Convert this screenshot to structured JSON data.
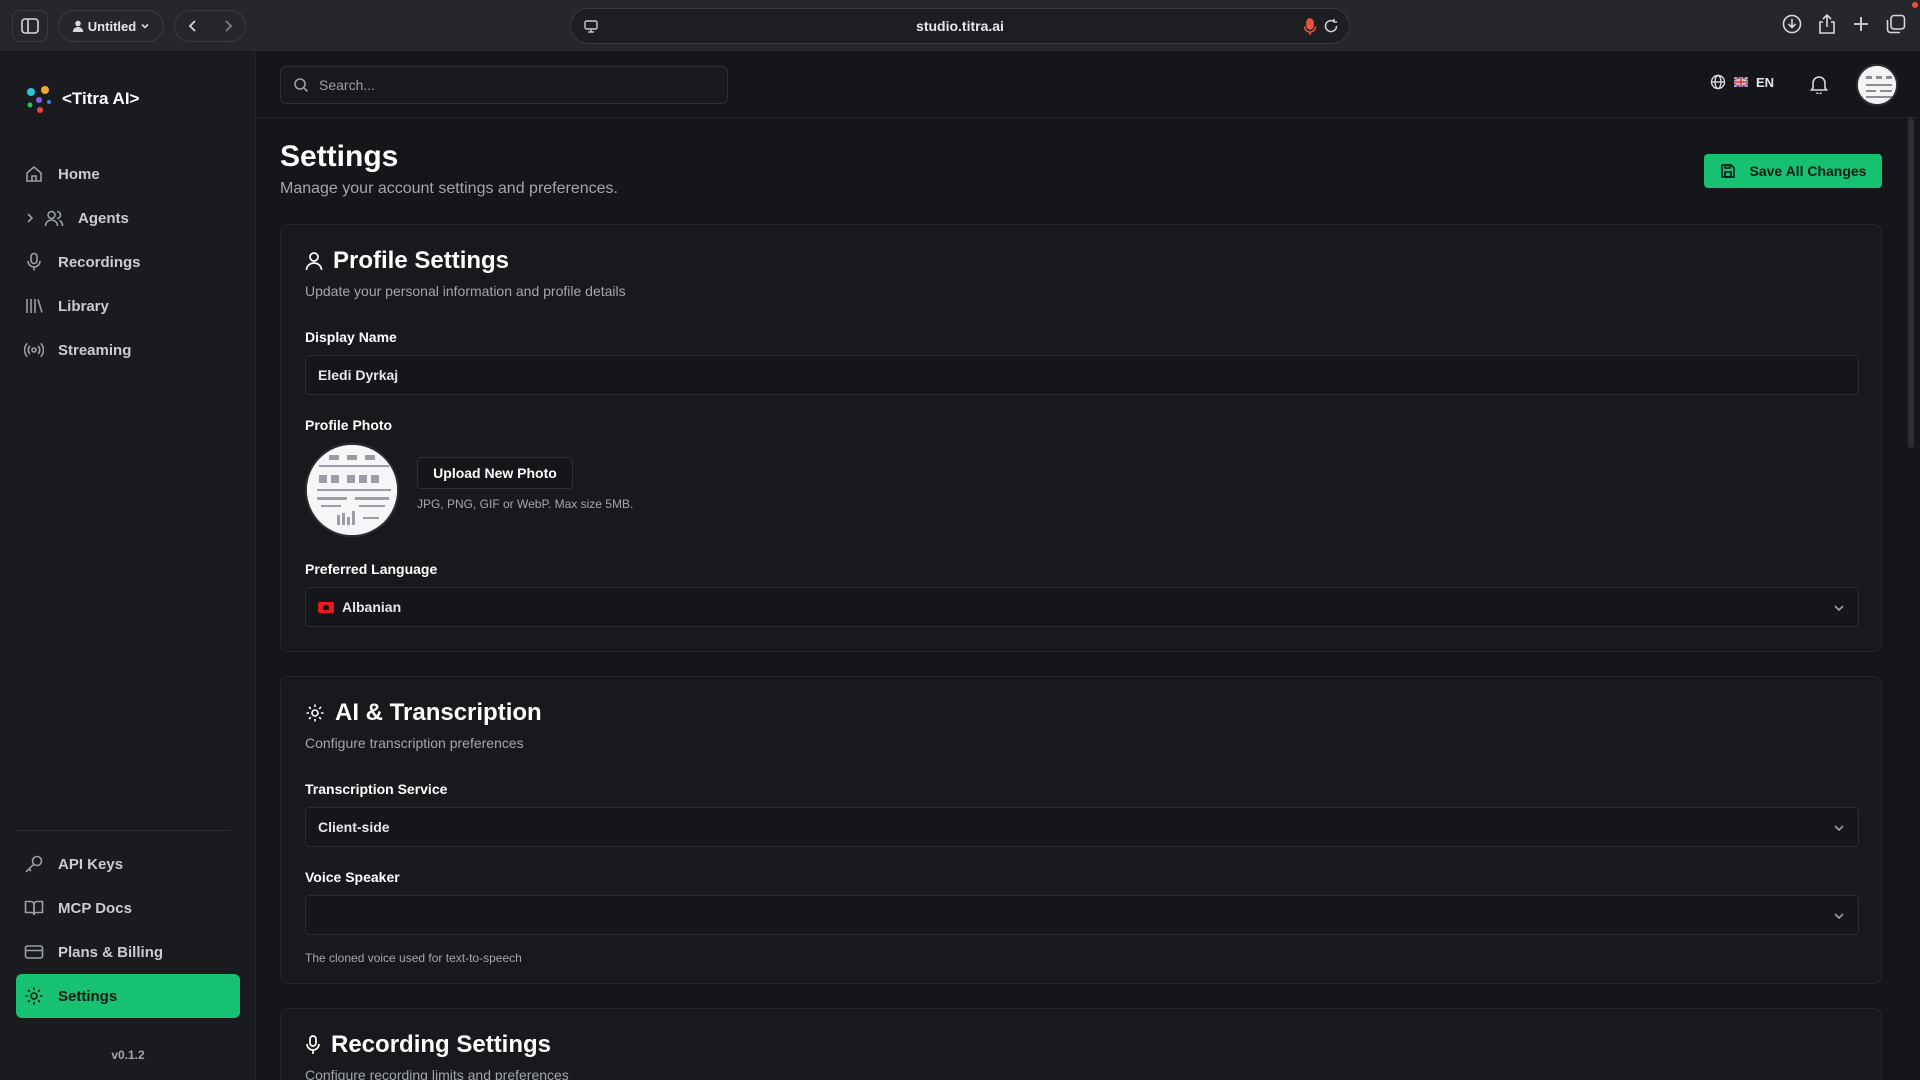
{
  "browser": {
    "profile_label": "Untitled",
    "url": "studio.titra.ai"
  },
  "brand": {
    "name": "<Titra AI>"
  },
  "sidebar": {
    "items": [
      {
        "label": "Home",
        "icon": "home-icon"
      },
      {
        "label": "Agents",
        "icon": "users-icon"
      },
      {
        "label": "Recordings",
        "icon": "mic-icon"
      },
      {
        "label": "Library",
        "icon": "library-icon"
      },
      {
        "label": "Streaming",
        "icon": "broadcast-icon"
      }
    ],
    "bottom_items": [
      {
        "label": "API Keys",
        "icon": "key-icon"
      },
      {
        "label": "MCP Docs",
        "icon": "book-icon"
      },
      {
        "label": "Plans & Billing",
        "icon": "credit-card-icon"
      },
      {
        "label": "Settings",
        "icon": "gear-icon",
        "active": true
      }
    ],
    "version": "v0.1.2"
  },
  "topbar": {
    "search_placeholder": "Search...",
    "language_code": "EN"
  },
  "page": {
    "title": "Settings",
    "subtitle": "Manage your account settings and preferences.",
    "save_label": "Save All Changes"
  },
  "profile": {
    "title": "Profile Settings",
    "subtitle": "Update your personal information and profile details",
    "display_name_label": "Display Name",
    "display_name_value": "Eledi Dyrkaj",
    "photo_label": "Profile Photo",
    "upload_label": "Upload New Photo",
    "upload_hint": "JPG, PNG, GIF or WebP. Max size 5MB.",
    "language_label": "Preferred Language",
    "language_value": "Albanian"
  },
  "ai": {
    "title": "AI & Transcription",
    "subtitle": "Configure transcription preferences",
    "service_label": "Transcription Service",
    "service_value": "Client-side",
    "voice_label": "Voice Speaker",
    "voice_value": "",
    "voice_hint": "The cloned voice used for text-to-speech"
  },
  "recording": {
    "title": "Recording Settings",
    "subtitle": "Configure recording limits and preferences"
  },
  "colors": {
    "accent": "#16c172",
    "background": "#141619",
    "card": "#17191c"
  }
}
